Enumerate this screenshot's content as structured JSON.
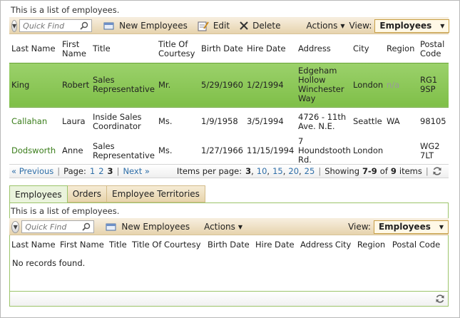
{
  "master": {
    "description": "This is a list of employees.",
    "quick_find_placeholder": "Quick Find",
    "buttons": {
      "new": "New Employees",
      "edit": "Edit",
      "delete": "Delete",
      "actions": "Actions"
    },
    "view_label": "View:",
    "view_value": "Employees",
    "columns": [
      "Last Name",
      "First Name",
      "Title",
      "Title Of Courtesy",
      "Birth Date",
      "Hire Date",
      "Address",
      "City",
      "Region",
      "Postal Code"
    ],
    "rows": [
      {
        "last": "King",
        "first": "Robert",
        "title": "Sales Representative",
        "courtesy": "Mr.",
        "birth": "5/29/1960",
        "hire": "1/2/1994",
        "address": "Edgeham Hollow Winchester Way",
        "city": "London",
        "region": "n/a",
        "postal": "RG1 9SP"
      },
      {
        "last": "Callahan",
        "first": "Laura",
        "title": "Inside Sales Coordinator",
        "courtesy": "Ms.",
        "birth": "1/9/1958",
        "hire": "3/5/1994",
        "address": "4726 - 11th Ave. N.E.",
        "city": "Seattle",
        "region": "WA",
        "postal": "98105"
      },
      {
        "last": "Dodsworth",
        "first": "Anne",
        "title": "Sales Representative",
        "courtesy": "Ms.",
        "birth": "1/27/1966",
        "hire": "11/15/1994",
        "address": "7 Houndstooth Rd.",
        "city": "London",
        "region": "",
        "postal": "WG2 7LT"
      }
    ],
    "pager": {
      "previous": "« Previous",
      "page_label": "Page:",
      "pages": [
        "1",
        "2",
        "3"
      ],
      "next": "Next »",
      "items_per_page_label": "Items per page:",
      "sizes": [
        "3",
        "10",
        "15",
        "20",
        "25"
      ],
      "showing_prefix": "Showing",
      "range": "7-9",
      "of": "of",
      "total": "9",
      "items": "items"
    }
  },
  "tabs": [
    "Employees",
    "Orders",
    "Employee Territories"
  ],
  "detail": {
    "description": "This is a list of employees.",
    "quick_find_placeholder": "Quick Find",
    "buttons": {
      "new": "New Employees",
      "actions": "Actions"
    },
    "view_label": "View:",
    "view_value": "Employees",
    "columns": [
      "Last Name",
      "First Name",
      "Title",
      "Title Of Courtesy",
      "Birth Date",
      "Hire Date",
      "Address",
      "City",
      "Region",
      "Postal Code"
    ],
    "empty_message": "No records found."
  }
}
